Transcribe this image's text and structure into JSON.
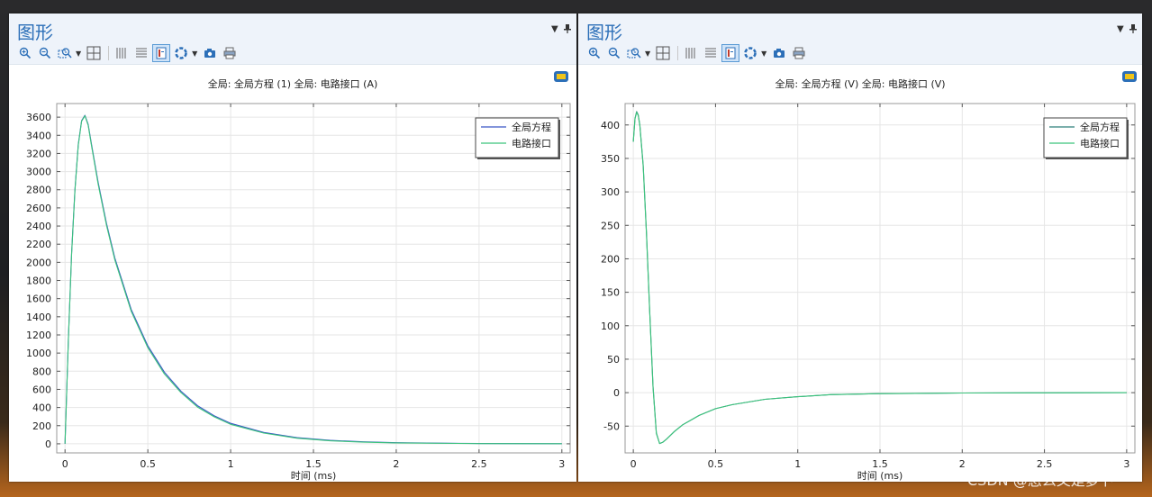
{
  "panels": [
    {
      "title": "图形",
      "plot_title": "全局: 全局方程 (1)  全局: 电路接口 (A)"
    },
    {
      "title": "图形",
      "plot_title": "全局: 全局方程 (V)  全局: 电路接口 (V)"
    }
  ],
  "toolbar_icons": [
    "zoom-in-icon",
    "zoom-out-icon",
    "zoom-box-icon",
    "zoom-extents-icon",
    "x-grid-icon",
    "y-grid-icon",
    "legend-icon",
    "color-table-icon",
    "camera-icon",
    "print-icon"
  ],
  "watermark": "CSDN @怎么又是萝卜",
  "chart_data": [
    {
      "type": "line",
      "title": "全局: 全局方程 (1)  全局: 电路接口 (A)",
      "xlabel": "时间 (ms)",
      "ylabel": "",
      "xlim": [
        -0.05,
        3.05
      ],
      "ylim": [
        -100,
        3750
      ],
      "xticks": [
        "0",
        "0.5",
        "1",
        "1.5",
        "2",
        "2.5",
        "3"
      ],
      "yticks": [
        "0",
        "200",
        "400",
        "600",
        "800",
        "1000",
        "1200",
        "1400",
        "1600",
        "1800",
        "2000",
        "2200",
        "2400",
        "2600",
        "2800",
        "3000",
        "3200",
        "3400",
        "3600"
      ],
      "grid": true,
      "legend_position": "top-right",
      "series": [
        {
          "name": "全局方程",
          "color": "#3a56c5",
          "x": [
            0,
            0.02,
            0.04,
            0.06,
            0.08,
            0.1,
            0.12,
            0.14,
            0.16,
            0.2,
            0.25,
            0.3,
            0.4,
            0.5,
            0.6,
            0.7,
            0.8,
            0.9,
            1.0,
            1.2,
            1.4,
            1.6,
            1.8,
            2.0,
            2.5,
            3.0
          ],
          "values": [
            0,
            1150,
            2100,
            2800,
            3300,
            3560,
            3620,
            3520,
            3300,
            2880,
            2430,
            2050,
            1480,
            1080,
            790,
            580,
            420,
            310,
            225,
            125,
            68,
            38,
            22,
            12,
            3,
            1
          ]
        },
        {
          "name": "电路接口",
          "color": "#3cc47c",
          "x": [
            0,
            0.02,
            0.04,
            0.06,
            0.08,
            0.1,
            0.12,
            0.14,
            0.16,
            0.2,
            0.25,
            0.3,
            0.4,
            0.5,
            0.6,
            0.7,
            0.8,
            0.9,
            1.0,
            1.2,
            1.4,
            1.6,
            1.8,
            2.0,
            2.5,
            3.0
          ],
          "values": [
            0,
            1140,
            2090,
            2790,
            3290,
            3555,
            3615,
            3510,
            3285,
            2860,
            2410,
            2030,
            1460,
            1060,
            770,
            565,
            405,
            298,
            215,
            118,
            62,
            33,
            18,
            10,
            2,
            1
          ]
        }
      ]
    },
    {
      "type": "line",
      "title": "全局: 全局方程 (V)  全局: 电路接口 (V)",
      "xlabel": "时间 (ms)",
      "ylabel": "",
      "xlim": [
        -0.05,
        3.05
      ],
      "ylim": [
        -90,
        432
      ],
      "xticks": [
        "0",
        "0.5",
        "1",
        "1.5",
        "2",
        "2.5",
        "3"
      ],
      "yticks": [
        "-50",
        "0",
        "50",
        "100",
        "150",
        "200",
        "250",
        "300",
        "350",
        "400"
      ],
      "grid": true,
      "legend_position": "top-right",
      "series": [
        {
          "name": "全局方程",
          "color": "#2f7f7a",
          "x": [
            0,
            0.01,
            0.02,
            0.03,
            0.04,
            0.06,
            0.08,
            0.1,
            0.12,
            0.14,
            0.16,
            0.18,
            0.2,
            0.25,
            0.3,
            0.4,
            0.5,
            0.6,
            0.8,
            1.0,
            1.2,
            1.5,
            2.0,
            2.5,
            3.0
          ],
          "values": [
            375,
            410,
            420,
            415,
            400,
            340,
            240,
            120,
            10,
            -60,
            -76,
            -74,
            -70,
            -58,
            -48,
            -34,
            -24,
            -18,
            -10,
            -6,
            -3,
            -1.5,
            -0.5,
            -0.2,
            0
          ]
        },
        {
          "name": "电路接口",
          "color": "#3cc47c",
          "x": [
            0,
            0.01,
            0.02,
            0.03,
            0.04,
            0.06,
            0.08,
            0.1,
            0.12,
            0.14,
            0.16,
            0.18,
            0.2,
            0.25,
            0.3,
            0.4,
            0.5,
            0.6,
            0.8,
            1.0,
            1.2,
            1.5,
            2.0,
            2.5,
            3.0
          ],
          "values": [
            375,
            409,
            419,
            414,
            399,
            338,
            238,
            118,
            8,
            -61,
            -76,
            -74,
            -70,
            -58,
            -48,
            -34,
            -24,
            -18,
            -10,
            -6,
            -3,
            -1.5,
            -0.5,
            -0.2,
            0
          ]
        }
      ]
    }
  ]
}
